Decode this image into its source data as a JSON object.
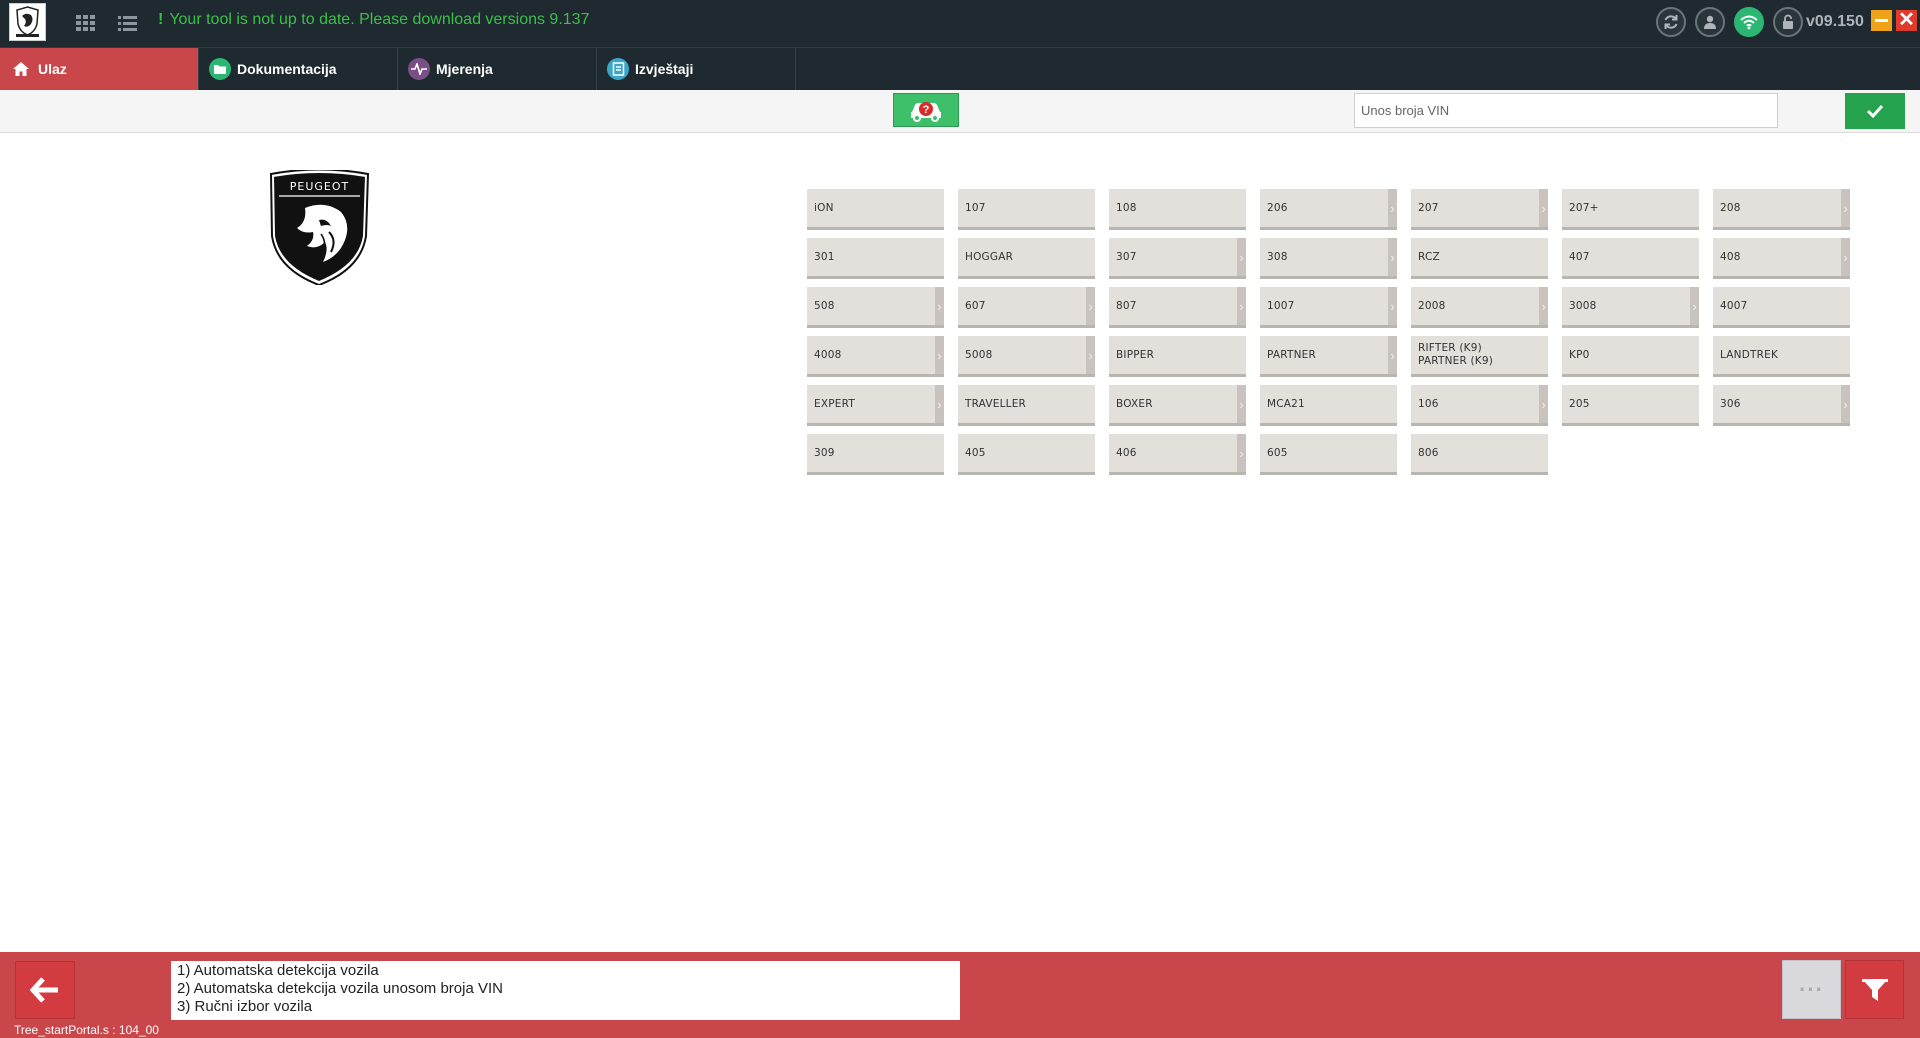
{
  "header": {
    "notice": "Your tool is not up to date. Please download versions 9.137",
    "notice_mark": "!",
    "version": "v09.150",
    "icons": [
      "sync-icon",
      "user-icon",
      "wifi-icon",
      "lock-icon"
    ],
    "close_glyph": "✕"
  },
  "tabs": [
    {
      "label": "Ulaz",
      "icon": "home-icon",
      "active": true
    },
    {
      "label": "Dokumentacija",
      "icon": "folder-icon",
      "active": false
    },
    {
      "label": "Mjerenja",
      "icon": "pulse-icon",
      "active": false
    },
    {
      "label": "Izvještaji",
      "icon": "report-icon",
      "active": false
    }
  ],
  "toolbar": {
    "vin_placeholder": "Unos broja VIN",
    "vin_value": ""
  },
  "brand": {
    "logo_text": "PEUGEOT"
  },
  "models": [
    {
      "label": "iON",
      "has_sub": false
    },
    {
      "label": "107",
      "has_sub": false
    },
    {
      "label": "108",
      "has_sub": false
    },
    {
      "label": "206",
      "has_sub": true
    },
    {
      "label": "207",
      "has_sub": true
    },
    {
      "label": "207+",
      "has_sub": false
    },
    {
      "label": "208",
      "has_sub": true
    },
    {
      "label": "301",
      "has_sub": false
    },
    {
      "label": "HOGGAR",
      "has_sub": false
    },
    {
      "label": "307",
      "has_sub": true
    },
    {
      "label": "308",
      "has_sub": true
    },
    {
      "label": "RCZ",
      "has_sub": false
    },
    {
      "label": "407",
      "has_sub": false
    },
    {
      "label": "408",
      "has_sub": true
    },
    {
      "label": "508",
      "has_sub": true
    },
    {
      "label": "607",
      "has_sub": true
    },
    {
      "label": "807",
      "has_sub": true
    },
    {
      "label": "1007",
      "has_sub": true
    },
    {
      "label": "2008",
      "has_sub": true
    },
    {
      "label": "3008",
      "has_sub": true
    },
    {
      "label": "4007",
      "has_sub": false
    },
    {
      "label": "4008",
      "has_sub": true
    },
    {
      "label": "5008",
      "has_sub": true
    },
    {
      "label": "BIPPER",
      "has_sub": false
    },
    {
      "label": "PARTNER",
      "has_sub": true
    },
    {
      "label": "RIFTER (K9)\nPARTNER (K9)",
      "has_sub": false
    },
    {
      "label": "KP0",
      "has_sub": false
    },
    {
      "label": "LANDTREK",
      "has_sub": false
    },
    {
      "label": "EXPERT",
      "has_sub": true
    },
    {
      "label": "TRAVELLER",
      "has_sub": false
    },
    {
      "label": "BOXER",
      "has_sub": true
    },
    {
      "label": "MCA21",
      "has_sub": false
    },
    {
      "label": "106",
      "has_sub": true
    },
    {
      "label": "205",
      "has_sub": false
    },
    {
      "label": "306",
      "has_sub": true
    },
    {
      "label": "309",
      "has_sub": false
    },
    {
      "label": "405",
      "has_sub": false
    },
    {
      "label": "406",
      "has_sub": true
    },
    {
      "label": "605",
      "has_sub": false
    },
    {
      "label": "806",
      "has_sub": false
    }
  ],
  "footer": {
    "info_lines": [
      "1) Automatska detekcija vozila",
      "2) Automatska detekcija vozila unosom broja VIN",
      "3) Ručni izbor vozila"
    ],
    "status": "Tree_startPortal.s : 104_00",
    "more_label": "···"
  },
  "colors": {
    "accent_red": "#c9464b",
    "header_bg": "#1f2a30",
    "notice_green": "#3bbf4a",
    "ok_green": "#25a24d",
    "tile_bg": "#e3dfdb"
  }
}
